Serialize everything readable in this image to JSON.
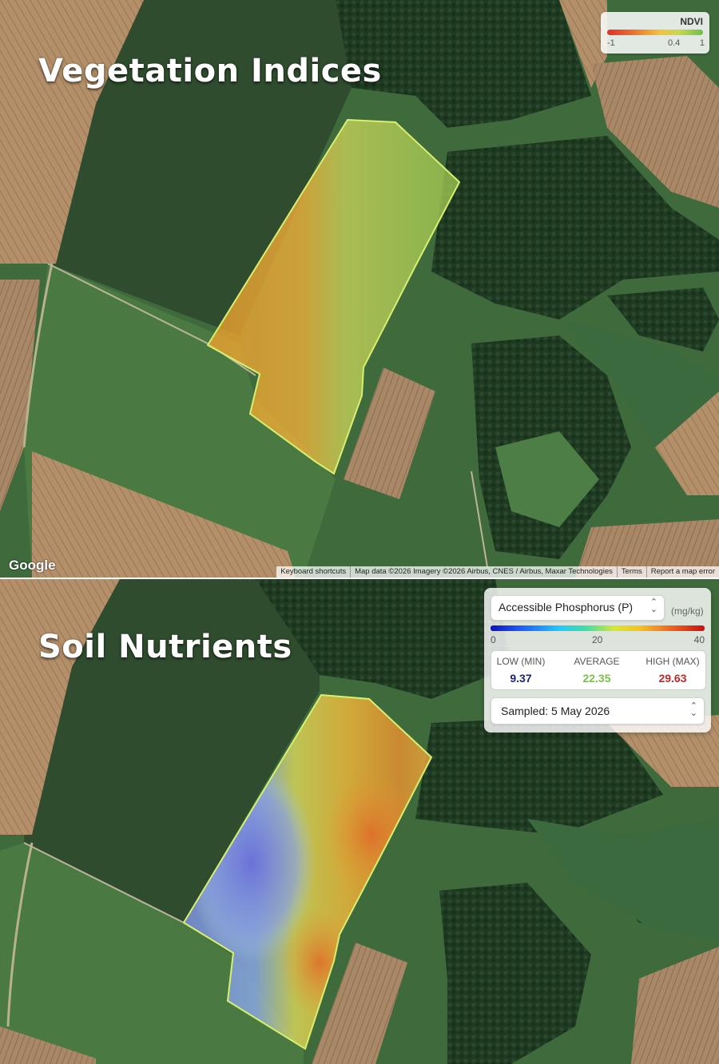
{
  "colors": {
    "ndvi_low": "#e0302a",
    "ndvi_high": "#6cc04a",
    "phosphorus_low": "#1a237e",
    "phosphorus_avg": "#7cc04a",
    "phosphorus_high": "#c62828",
    "field_outline": "#d8f070"
  },
  "vegetation": {
    "title": "Vegetation Indices",
    "legend": {
      "title": "NDVI",
      "ticks": [
        "-1",
        "0.4",
        "1"
      ]
    },
    "google_logo": "Google",
    "attribution": [
      "Keyboard shortcuts",
      "Map data ©2026 Imagery ©2026 Airbus, CNES / Airbus, Maxar Technologies",
      "Terms",
      "Report a map error"
    ]
  },
  "nutrients": {
    "title": "Soil Nutrients",
    "nutrient_select": "Accessible Phosphorus (P)",
    "unit": "(mg/kg)",
    "scale_ticks": [
      "0",
      "20",
      "40"
    ],
    "stats": {
      "low_label": "LOW (MIN)",
      "low_value": "9.37",
      "avg_label": "AVERAGE",
      "avg_value": "22.35",
      "high_label": "HIGH (MAX)",
      "high_value": "29.63"
    },
    "sampled_select": "Sampled: 5 May 2026"
  }
}
